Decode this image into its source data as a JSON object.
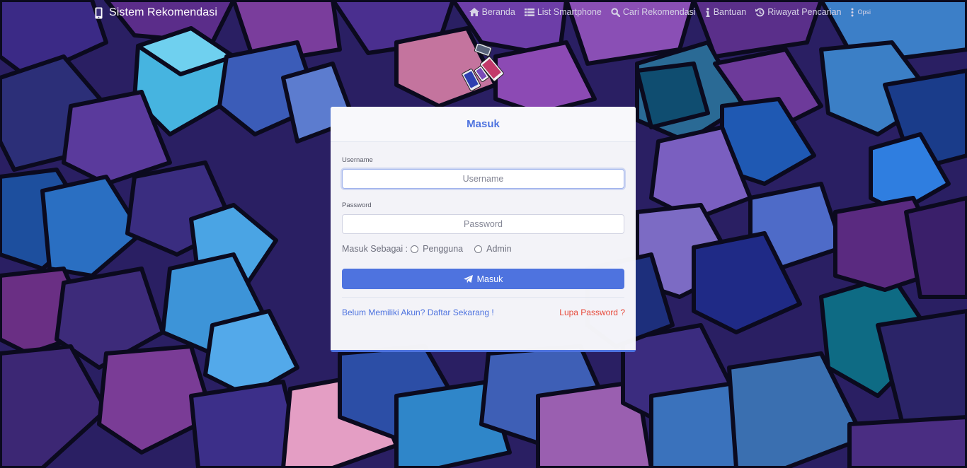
{
  "brand": {
    "title": "Sistem Rekomendasi",
    "icon": "mobile-phone-icon"
  },
  "nav": {
    "items": [
      {
        "label": "Beranda",
        "icon": "home-icon"
      },
      {
        "label": "List Smartphone",
        "icon": "list-icon"
      },
      {
        "label": "Cari Rekomendasi",
        "icon": "search-icon"
      },
      {
        "label": "Bantuan",
        "icon": "info-icon"
      },
      {
        "label": "Riwayat Pencarian",
        "icon": "history-icon"
      },
      {
        "label": "Opsi",
        "icon": "more-vertical-icon"
      }
    ]
  },
  "login": {
    "title": "Masuk",
    "username": {
      "label": "Username",
      "placeholder": "Username",
      "value": ""
    },
    "password": {
      "label": "Password",
      "placeholder": "Password",
      "value": ""
    },
    "role": {
      "label": "Masuk Sebagai :",
      "options": [
        "Pengguna",
        "Admin"
      ],
      "selected": null
    },
    "submit_label": "Masuk",
    "register_link": "Belum Memiliki Akun? Daftar Sekarang !",
    "forgot_link": "Lupa Password ?"
  },
  "colors": {
    "primary": "#4e73df",
    "danger": "#e74a3b",
    "background": "#2a1f63"
  }
}
